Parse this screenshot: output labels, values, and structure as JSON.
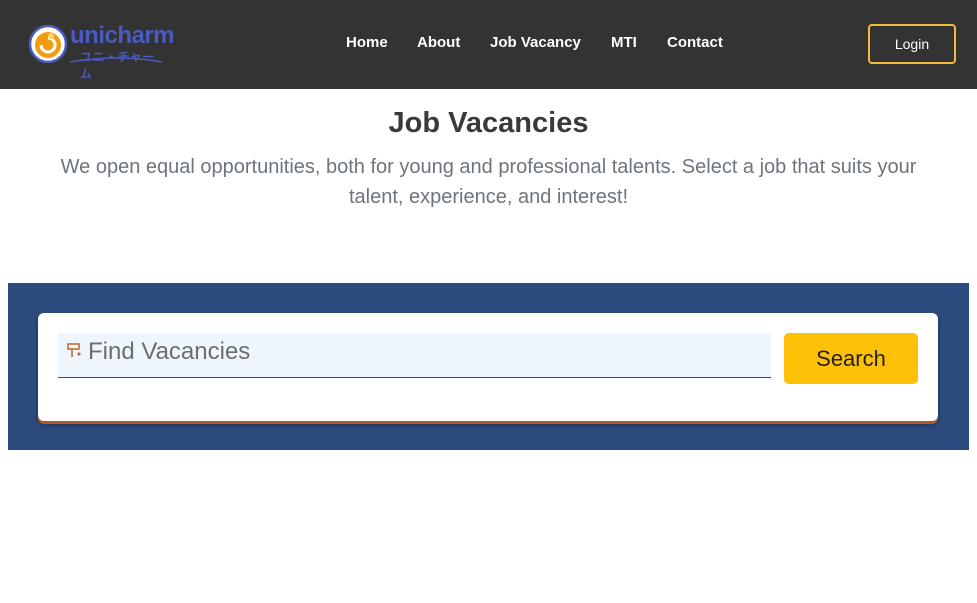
{
  "header": {
    "logo": {
      "wordmark": "unicharm",
      "kana": "ユニ・チャーム",
      "icon": "unicharm-logo-icon"
    },
    "nav": [
      {
        "label": "Home"
      },
      {
        "label": "About"
      },
      {
        "label": "Job Vacancy"
      },
      {
        "label": "MTI"
      },
      {
        "label": "Contact"
      }
    ],
    "login_label": "Login"
  },
  "main": {
    "title": "Job Vacancies",
    "subtitle": "We open equal opportunities, both for young and professional talents. Select a job that suits your talent, experience, and interest!"
  },
  "search": {
    "placeholder": "Find Vacancies",
    "value": "",
    "button_label": "Search",
    "icon": "filter-icon"
  },
  "colors": {
    "navbar": "#333333",
    "brand": "#4a5bbf",
    "accent": "#ffc107",
    "login_border": "#f5b942",
    "band": "#2d4b7e"
  }
}
